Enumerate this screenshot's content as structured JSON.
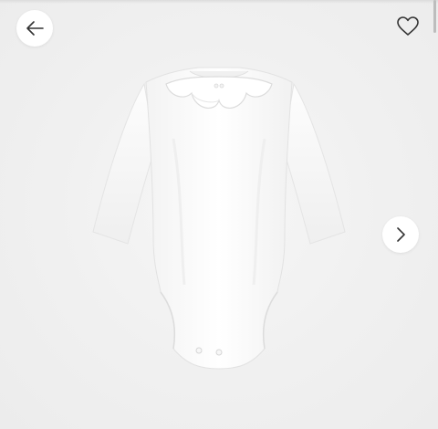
{
  "gallery": {
    "back_button": {
      "icon": "arrow-left-icon"
    },
    "wishlist_button": {
      "icon": "heart-outline-icon"
    },
    "next_button": {
      "icon": "chevron-right-icon"
    },
    "product_image": {
      "subject": "long-sleeve-baby-bodysuit"
    }
  },
  "colors": {
    "background": "#f1f1f1",
    "button_bg": "#ffffff",
    "icon": "#333333",
    "garment": "#ffffff"
  }
}
